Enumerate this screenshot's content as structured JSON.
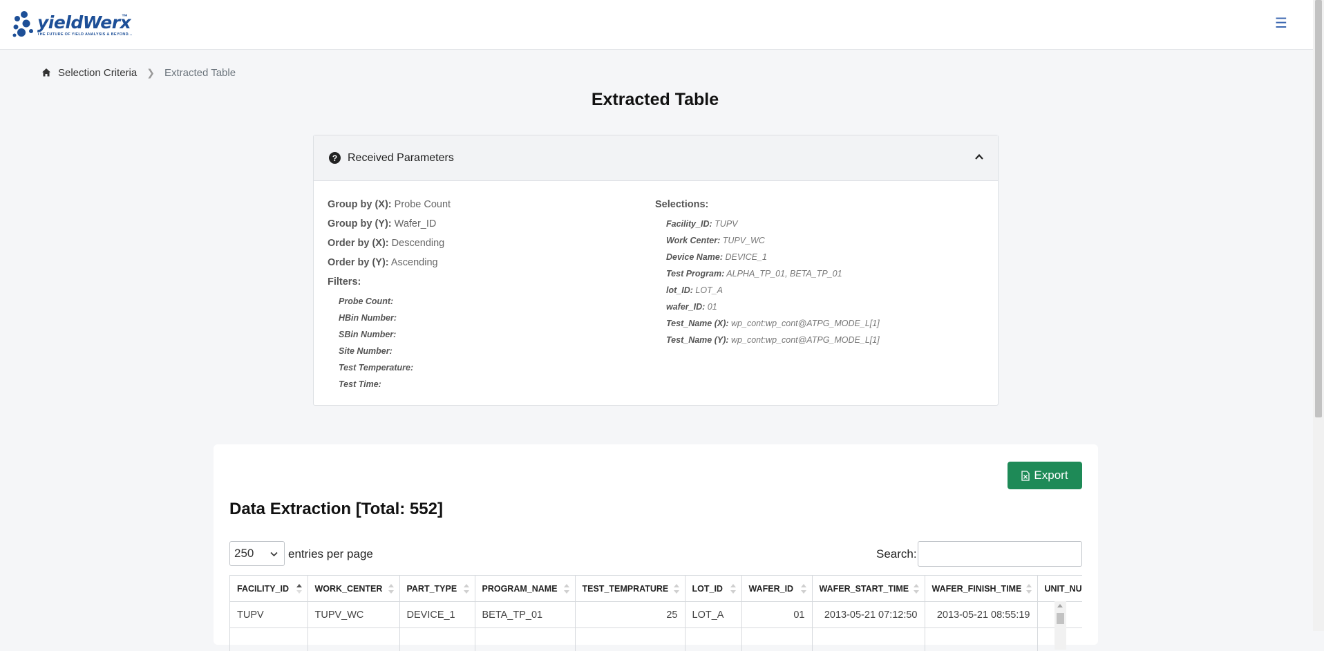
{
  "app": {
    "logo_text": "yieldWerx",
    "logo_tm": "™",
    "logo_tagline": "THE FUTURE OF YIELD ANALYSIS & BEYOND...",
    "menu_icon": "hamburger-icon"
  },
  "breadcrumb": {
    "home_icon": "home-icon",
    "items": [
      "Selection Criteria",
      "Extracted Table"
    ]
  },
  "page_title": "Extracted Table",
  "params": {
    "title": "Received Parameters",
    "group_x": {
      "label": "Group by (X):",
      "value": "Probe Count"
    },
    "group_y": {
      "label": "Group by (Y):",
      "value": "Wafer_ID"
    },
    "order_x": {
      "label": "Order by (X):",
      "value": "Descending"
    },
    "order_y": {
      "label": "Order by (Y):",
      "value": "Ascending"
    },
    "filters_label": "Filters:",
    "filters": [
      {
        "label": "Probe Count:",
        "value": ""
      },
      {
        "label": "HBin Number:",
        "value": ""
      },
      {
        "label": "SBin Number:",
        "value": ""
      },
      {
        "label": "Site Number:",
        "value": ""
      },
      {
        "label": "Test Temperature:",
        "value": ""
      },
      {
        "label": "Test Time:",
        "value": ""
      }
    ],
    "selections_label": "Selections:",
    "selections": [
      {
        "label": "Facility_ID:",
        "value": "TUPV"
      },
      {
        "label": "Work Center:",
        "value": "TUPV_WC"
      },
      {
        "label": "Device Name:",
        "value": "DEVICE_1"
      },
      {
        "label": "Test Program:",
        "value": "ALPHA_TP_01, BETA_TP_01"
      },
      {
        "label": "lot_ID:",
        "value": "LOT_A"
      },
      {
        "label": "wafer_ID:",
        "value": "01"
      },
      {
        "label": "Test_Name (X):",
        "value": "wp_cont:wp_cont@ATPG_MODE_L[1]"
      },
      {
        "label": "Test_Name (Y):",
        "value": "wp_cont:wp_cont@ATPG_MODE_L[1]"
      }
    ]
  },
  "extraction": {
    "export_label": "Export",
    "title": "Data Extraction [Total: 552]",
    "entries_value": "250",
    "entries_label": "entries per page",
    "search_label": "Search:",
    "search_value": "",
    "columns": [
      "FACILITY_ID",
      "WORK_CENTER",
      "PART_TYPE",
      "PROGRAM_NAME",
      "TEST_TEMPRATURE",
      "LOT_ID",
      "WAFER_ID",
      "WAFER_START_TIME",
      "WAFER_FINISH_TIME",
      "UNIT_NUMBER"
    ],
    "rows": [
      [
        "TUPV",
        "TUPV_WC",
        "DEVICE_1",
        "BETA_TP_01",
        "25",
        "LOT_A",
        "01",
        "2013-05-21 07:12:50",
        "2013-05-21 08:55:19",
        ""
      ]
    ]
  }
}
